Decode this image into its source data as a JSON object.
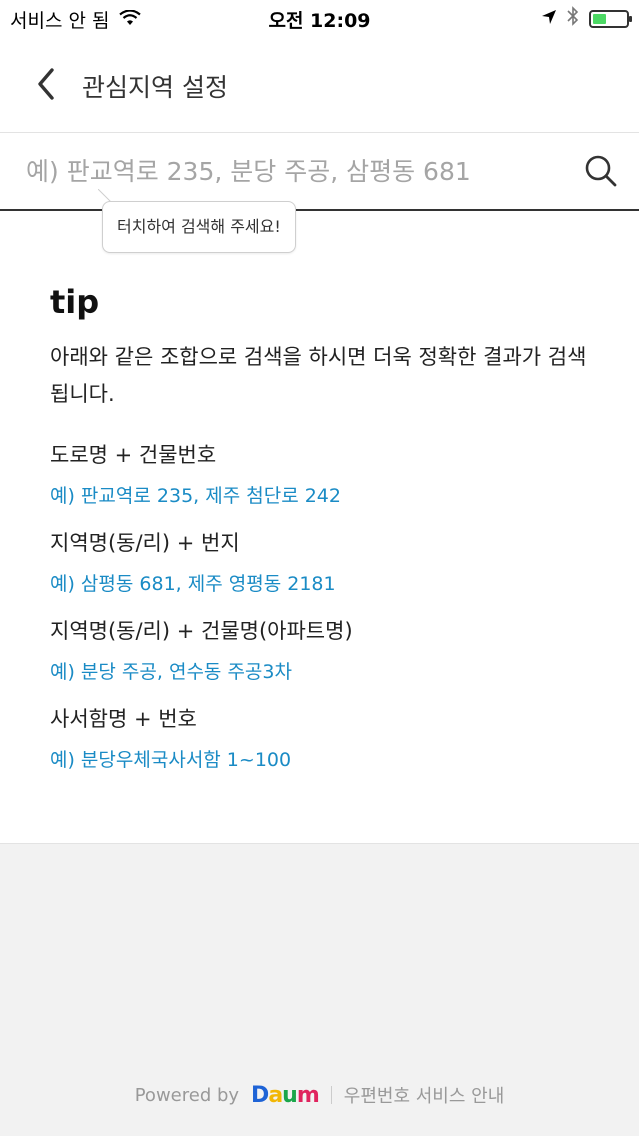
{
  "status_bar": {
    "carrier": "서비스 안 됨",
    "time": "오전 12:09",
    "battery_level": 0.4
  },
  "header": {
    "title": "관심지역 설정",
    "back_icon": "chevron-left-icon"
  },
  "search": {
    "placeholder": "예) 판교역로 235, 분당 주공, 삼평동 681",
    "value": "",
    "icon": "search-icon",
    "tooltip": "터치하여 검색해 주세요!"
  },
  "tip": {
    "title": "tip",
    "description": "아래와 같은 조합으로 검색을 하시면 더욱 정확한 결과가 검색됩니다.",
    "items": [
      {
        "label": "도로명 + 건물번호",
        "example": "예) 판교역로 235,  제주 첨단로 242"
      },
      {
        "label": "지역명(동/리) + 번지",
        "example": "예) 삼평동 681,  제주 영평동 2181"
      },
      {
        "label": "지역명(동/리) + 건물명(아파트명)",
        "example": "예) 분당 주공,  연수동 주공3차"
      },
      {
        "label": "사서함명 + 번호",
        "example": "예) 분당우체국사서함 1~100"
      }
    ]
  },
  "footer": {
    "powered_by": "Powered by",
    "brand_letters": [
      "D",
      "a",
      "u",
      "m"
    ],
    "brand_colors": [
      "#1e63d6",
      "#f2b705",
      "#1aa64a",
      "#e0245e"
    ],
    "guide_link": "우편번호 서비스 안내"
  },
  "colors": {
    "accent": "#1a8bc5",
    "battery": "#4cd964"
  }
}
